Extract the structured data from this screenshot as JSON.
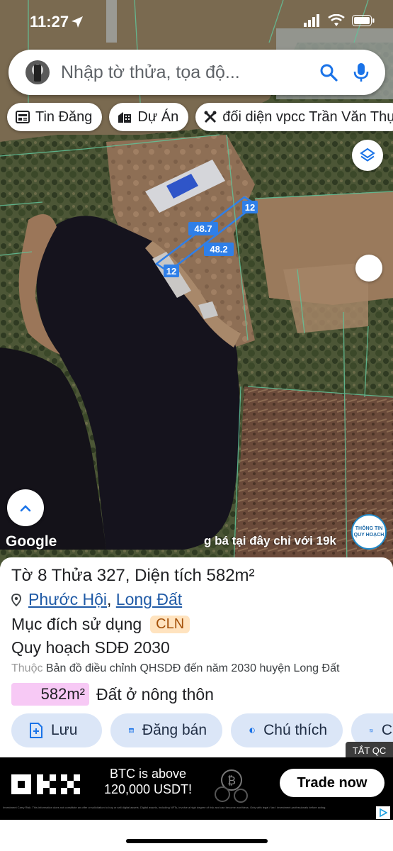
{
  "status_bar": {
    "time": "11:27"
  },
  "search": {
    "placeholder": "Nhập tờ thửa, tọa độ...",
    "value": ""
  },
  "chips": [
    {
      "label": "Tin Đăng",
      "icon": "newspaper-icon"
    },
    {
      "label": "Dự Án",
      "icon": "building-icon"
    },
    {
      "label": "đối diện vpcc Trần Văn Thụ",
      "icon": "tools-icon"
    }
  ],
  "map": {
    "parcel_dimensions": {
      "top": "12",
      "upper": "48.7",
      "lower": "48.2",
      "left": "12"
    },
    "google_label": "Google",
    "ticker_text": "g bá tại đây chỉ với 19k",
    "planning_badge": {
      "line1": "THÔNG TIN",
      "line2": "QUY HOẠCH"
    },
    "parcel_outline_color": "#2f7fe8"
  },
  "parcel": {
    "title": "Tờ 8 Thửa 327, Diện tích 582m²",
    "ward": "Phước Hội",
    "district": "Long Đất",
    "separator": ",",
    "purpose_label": "Mục đích sử dụng",
    "purpose_code": "CLN",
    "plan_label": "Quy hoạch SDĐ 2030",
    "source_prefix": "Thuộc",
    "source_text": "Bản đồ điều chỉnh QHSDĐ đến năm 2030 huyện Long Đất",
    "area_value": "582m²",
    "land_use": "Đất ở nông thôn",
    "area_chip_color": "#f7c9f5"
  },
  "actions": [
    {
      "label": "Lưu",
      "icon": "add-file-icon"
    },
    {
      "label": "Đăng bán",
      "icon": "listing-icon"
    },
    {
      "label": "Chú thích",
      "icon": "contrast-icon"
    },
    {
      "label": "C",
      "icon": "add-photo-icon"
    }
  ],
  "close_ad_label": "TẮT QC",
  "ad": {
    "brand": "OKX",
    "headline_1": "BTC is above",
    "headline_2": "120,000 USDT!",
    "cta": "Trade now",
    "disclaimer": "Investment Carry Risk. This information does not constitute an offer or solicitation to buy or sell digital assets. Digital assets, including NFTs, involve a high degree of risk and can become worthless. Only with legal / tax / investment professionals before acting."
  }
}
